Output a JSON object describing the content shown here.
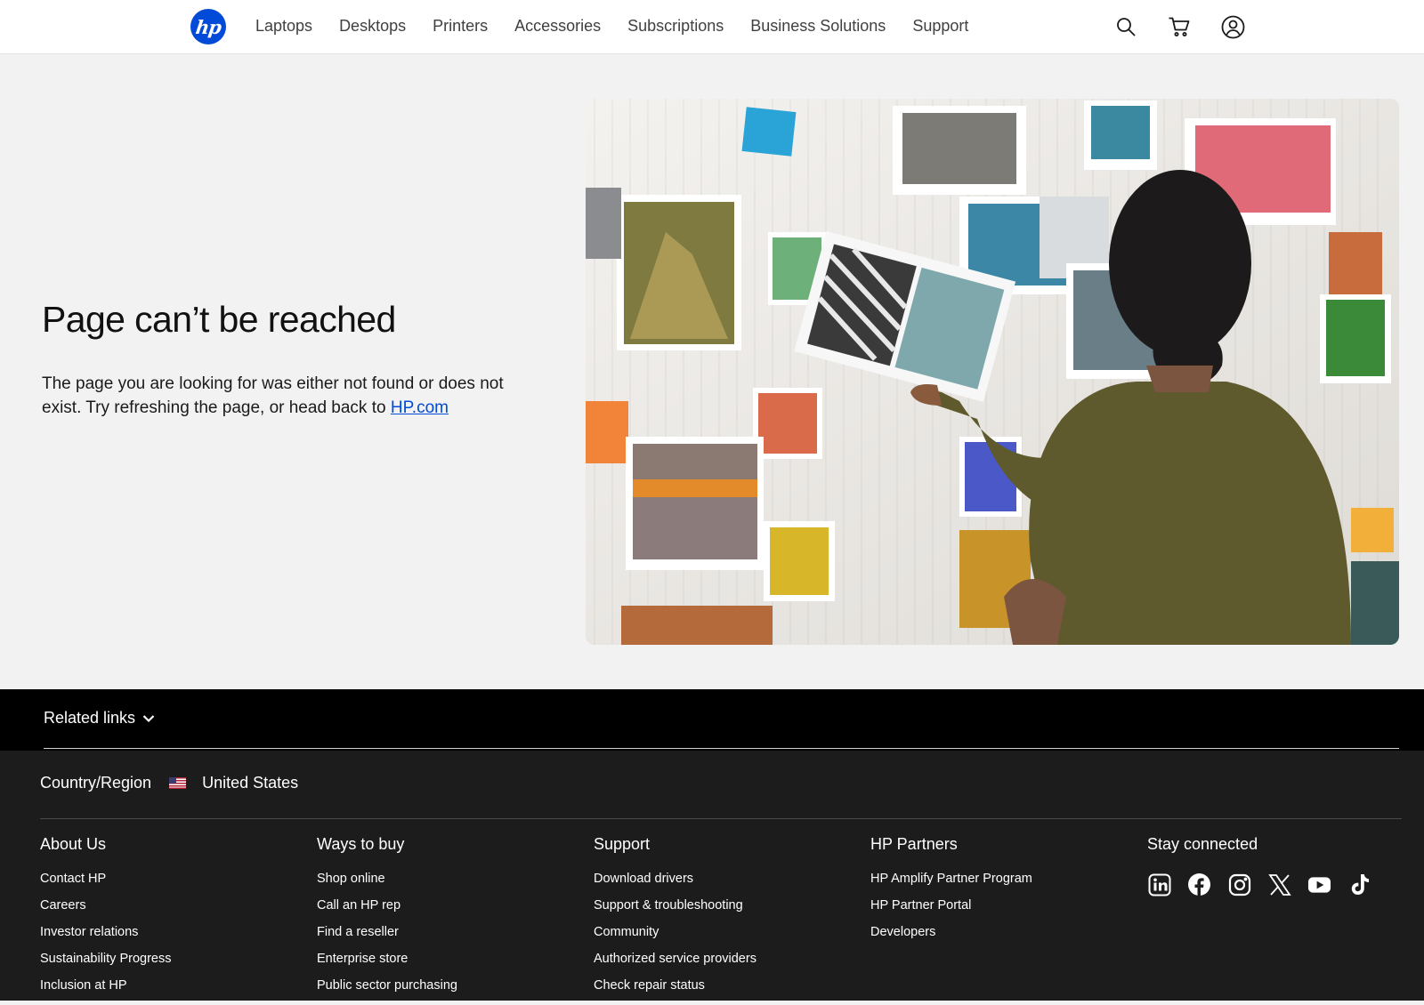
{
  "header": {
    "logo_text": "hp",
    "nav": [
      "Laptops",
      "Desktops",
      "Printers",
      "Accessories",
      "Subscriptions",
      "Business Solutions",
      "Support"
    ],
    "icons": [
      "search-icon",
      "cart-icon",
      "account-icon"
    ]
  },
  "hero": {
    "title": "Page can’t be reached",
    "text_before": "The page you are looking for was either not found or does not exist. Try refreshing the page, or head back to ",
    "link_text": "HP.com"
  },
  "related": {
    "label": "Related links"
  },
  "footer": {
    "country_label": "Country/Region",
    "country_value": "United States",
    "columns": [
      {
        "title": "About Us",
        "links": [
          "Contact HP",
          "Careers",
          "Investor relations",
          "Sustainability Progress",
          "Inclusion at HP"
        ]
      },
      {
        "title": "Ways to buy",
        "links": [
          "Shop online",
          "Call an HP rep",
          "Find a reseller",
          "Enterprise store",
          "Public sector purchasing"
        ]
      },
      {
        "title": "Support",
        "links": [
          "Download drivers",
          "Support & troubleshooting",
          "Community",
          "Authorized service providers",
          "Check repair status"
        ]
      },
      {
        "title": "HP Partners",
        "links": [
          "HP Amplify Partner Program",
          "HP Partner Portal",
          "Developers"
        ]
      },
      {
        "title": "Stay connected",
        "links": []
      }
    ],
    "socials": [
      "linkedin-icon",
      "facebook-icon",
      "instagram-icon",
      "x-icon",
      "youtube-icon",
      "tiktok-icon"
    ]
  },
  "colors": {
    "brand_blue": "#024ad8",
    "footer_bg": "#1c1c1c",
    "related_bg": "#000000",
    "page_bg": "#f2f2f2"
  }
}
